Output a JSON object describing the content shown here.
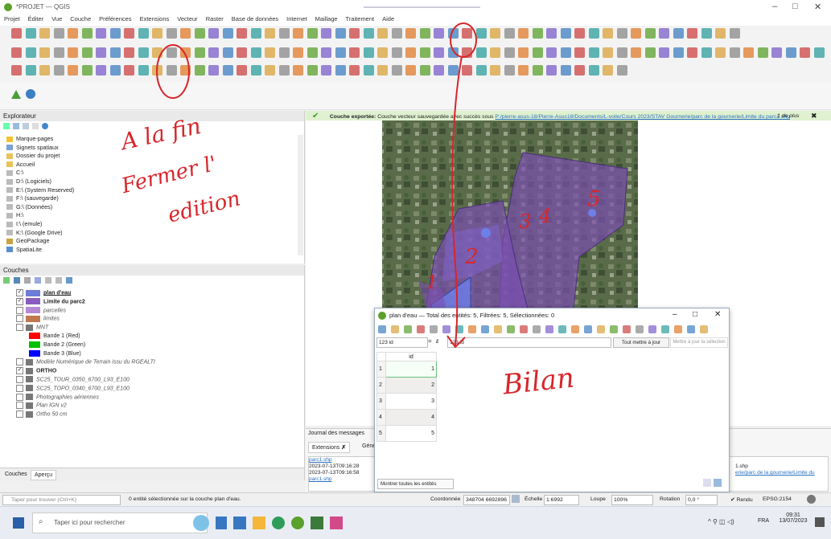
{
  "window": {
    "title": "*PROJET — QGIS",
    "minimize": "–",
    "maximize": "□",
    "close": "✕"
  },
  "menu": [
    "Projet",
    "Éditer",
    "Vue",
    "Couche",
    "Préférences",
    "Extensions",
    "Vecteur",
    "Raster",
    "Base de données",
    "Internet",
    "Maillage",
    "Traitement",
    "Aide"
  ],
  "colors": {
    "accent": "#2f6fb3",
    "annotation": "#d8262b",
    "polygon_violet": "#7b4fb0",
    "polygon_blue": "#5b6ee8",
    "success_green": "#5aa02c"
  },
  "explorer": {
    "title": "Explorateur",
    "items": [
      {
        "label": "Marque-pages",
        "icon": "star-icon"
      },
      {
        "label": "Signets spatiaux",
        "icon": "bookmark-icon"
      },
      {
        "label": "Dossier du projet",
        "icon": "folder-icon"
      },
      {
        "label": "Accueil",
        "icon": "folder-icon"
      },
      {
        "label": "C:\\",
        "icon": "drive-icon"
      },
      {
        "label": "D:\\ (Logiciels)",
        "icon": "drive-icon"
      },
      {
        "label": "E:\\ (System Reserved)",
        "icon": "drive-icon"
      },
      {
        "label": "F:\\ (sauvegarde)",
        "icon": "drive-icon"
      },
      {
        "label": "G:\\ (Données)",
        "icon": "drive-icon"
      },
      {
        "label": "H:\\",
        "icon": "drive-icon"
      },
      {
        "label": "I:\\ (emule)",
        "icon": "drive-icon"
      },
      {
        "label": "K:\\ (Google Drive)",
        "icon": "drive-icon"
      },
      {
        "label": "GeoPackage",
        "icon": "geopackage-icon"
      },
      {
        "label": "SpatiaLite",
        "icon": "spatialite-icon"
      }
    ]
  },
  "layers": {
    "title": "Couches",
    "items": [
      {
        "label": "plan d'eau",
        "checked": true,
        "color": "#6d7bd9",
        "bold": true,
        "underline": true
      },
      {
        "label": "Limite du parc2",
        "checked": true,
        "color": "#8a5cc0",
        "bold": true
      },
      {
        "label": "parcelles",
        "checked": false,
        "color": "#b48ad6",
        "italic": true
      },
      {
        "label": "limites",
        "checked": false,
        "color": "#c0784f",
        "italic": true
      },
      {
        "label": "MNT",
        "checked": false,
        "color": "#888888",
        "italic": true,
        "raster": true
      },
      {
        "label": "Bande 1 (Red)",
        "color": "#ff0000",
        "band": true
      },
      {
        "label": "Bande 2 (Green)",
        "color": "#00c000",
        "band": true
      },
      {
        "label": "Bande 3 (Blue)",
        "color": "#0000ff",
        "band": true
      },
      {
        "label": "Modèle Numérique de Terrain issu du RGEALTI",
        "checked": false,
        "italic": true,
        "raster": true
      },
      {
        "label": "ORTHO",
        "checked": true,
        "bold": true,
        "raster": true
      },
      {
        "label": "SC25_TOUR_0350_6700_L93_E100",
        "checked": false,
        "italic": true,
        "raster": true
      },
      {
        "label": "SC25_TOPO_0340_6700_L93_E100",
        "checked": false,
        "italic": true,
        "raster": true
      },
      {
        "label": "Photographies aériennes",
        "checked": false,
        "italic": true,
        "raster": true
      },
      {
        "label": "Plan IGN v2",
        "checked": false,
        "italic": true,
        "raster": true
      },
      {
        "label": "Ortho 50 cm",
        "checked": false,
        "italic": true,
        "raster": true
      }
    ],
    "tabs": [
      "Couches",
      "Aperçu"
    ]
  },
  "message": {
    "bold": "Couche exportée:",
    "text": "Couche vecteur sauvegardée avec succès sous",
    "link": "P:/pierre-asus-18/Pierre-Asus18/Documents/L-voile/Cours 2023/STAV Gournerie/parc de la gournerie/Limite du parc2.shp",
    "more": "1 de plus"
  },
  "attribute_table": {
    "title": "plan d'eau — Total des entités: 5, Filtrées: 5, Sélectionnées: 0",
    "field_select": "123 id",
    "expr_value": "123 id",
    "update_all": "Tout mettre à jour",
    "update_selection": "Mettre à jour la sélection",
    "column": "id",
    "rows": [
      {
        "n": "1",
        "id": "1"
      },
      {
        "n": "2",
        "id": "2"
      },
      {
        "n": "3",
        "id": "3"
      },
      {
        "n": "4",
        "id": "4"
      },
      {
        "n": "5",
        "id": "5"
      }
    ],
    "show_all": "Montrer toutes les entités"
  },
  "journal": {
    "title": "Journal des messages",
    "tabs": [
      "Extensions",
      "Géné"
    ],
    "lines": [
      "parc1.shp",
      "2023-07-13T09:16:28",
      "2023-07-13T09:16:58",
      "parc1.shp"
    ],
    "right_lines": [
      "1.shp",
      "erie/parc de la gournerie/Limite du"
    ]
  },
  "status": {
    "search_placeholder": "Taper pour trouver (Ctrl+K)",
    "selection_msg": "0 entité sélectionnée sur la couche plan d'eau.",
    "coord_label": "Coordonnée",
    "coord_value": "348704 6692896",
    "scale_label": "Échelle",
    "scale_value": "1:6992",
    "magnifier_label": "Loupe",
    "magnifier_value": "100%",
    "rotation_label": "Rotation",
    "rotation_value": "0,0 °",
    "render_label": "Rendu",
    "crs": "EPSG:2154"
  },
  "taskbar": {
    "search_placeholder": "Taper ici pour rechercher",
    "lang": "FRA",
    "time": "09:31",
    "date": "13/07/2023"
  },
  "annotations": {
    "a_la_fin": "A la fin",
    "fermer": "Fermer l'",
    "edition": "edition",
    "bilan": "Bilan",
    "map_numbers": [
      "1",
      "2",
      "3",
      "4",
      "5"
    ]
  }
}
